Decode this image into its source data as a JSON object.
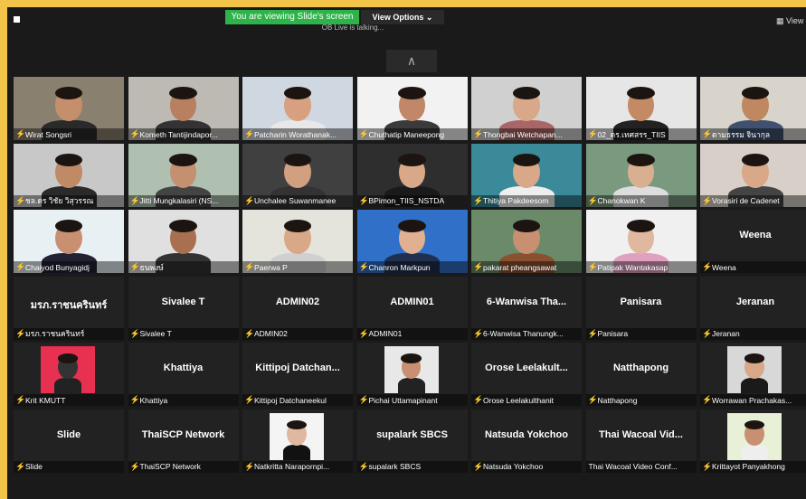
{
  "banner": "You are viewing Slide's screen",
  "view_options": "View Options ⌄",
  "talking": "OB Live is talking...",
  "view_label": "▦ View",
  "collapse_icon": "∧",
  "participants": [
    {
      "name": "Wirat Songsri",
      "video": true,
      "bg": "#8a8070",
      "skin": "#c48f6a",
      "shirt": "#2a2a2a"
    },
    {
      "name": "Kometh Tantijindapor...",
      "video": true,
      "bg": "#bdbab4",
      "skin": "#b88060",
      "shirt": "#333"
    },
    {
      "name": "Patcharin Worathanak...",
      "video": true,
      "bg": "#cfd8e0",
      "skin": "#d8a080",
      "shirt": "#e8e8e8"
    },
    {
      "name": "Chuthatip Maneepong",
      "video": true,
      "bg": "#f2f2f2",
      "skin": "#c08868",
      "shirt": "#3a3a3a"
    },
    {
      "name": "Thongbai Wetchapan...",
      "video": true,
      "bg": "#d0d0d0",
      "skin": "#d8a888",
      "shirt": "#aa6666"
    },
    {
      "name": "02_ดร.เทศสรร_TIIS",
      "video": true,
      "bg": "#e6e6e6",
      "skin": "#c48a64",
      "shirt": "#222"
    },
    {
      "name": "ดามธรรม จินากุล",
      "video": true,
      "bg": "#d8d4cc",
      "skin": "#c08860",
      "shirt": "#405070"
    },
    {
      "name": "ชล.ดร วิชัย  วิสุวรรณ",
      "video": true,
      "bg": "#c8c8c8",
      "skin": "#c08a66",
      "shirt": "#2a2a2a"
    },
    {
      "name": "Jitti Mungkalasiri (NS...",
      "video": true,
      "bg": "#b0c0b0",
      "skin": "#c49070",
      "shirt": "#444"
    },
    {
      "name": "Unchalee Suwanmanee",
      "video": true,
      "bg": "#404040",
      "skin": "#d0a080",
      "shirt": "#333"
    },
    {
      "name": "BPimon_TIIS_NSTDA",
      "video": true,
      "bg": "#2e2e2e",
      "skin": "#d8a888",
      "shirt": "#1a1a1a"
    },
    {
      "name": "Thitiya Pakdeesom",
      "video": true,
      "bg": "#3a8a9a",
      "skin": "#d8a888",
      "shirt": "#eeeeee"
    },
    {
      "name": "Chanokwan K",
      "video": true,
      "bg": "#7a9a80",
      "skin": "#d8b090",
      "shirt": "#ddd"
    },
    {
      "name": "Vorasiri de Cadenet",
      "video": true,
      "bg": "#d8d0c8",
      "skin": "#d8a888",
      "shirt": "#444"
    },
    {
      "name": "Chaiyod Bunyagidj",
      "video": true,
      "bg": "#e8f0f4",
      "skin": "#c89070",
      "shirt": "#223"
    },
    {
      "name": "ธนพงษ์",
      "video": true,
      "bg": "#e0e0e0",
      "skin": "#a87050",
      "shirt": "#333"
    },
    {
      "name": "Paerwa P",
      "video": true,
      "bg": "#e4e4dc",
      "skin": "#d8a888",
      "shirt": "#d0d0d0"
    },
    {
      "name": "Chanron  Markpun",
      "video": true,
      "bg": "#3070c8",
      "skin": "#e0b090",
      "shirt": "#203050"
    },
    {
      "name": "pakarat pheangsawat",
      "video": true,
      "bg": "#6a8a6a",
      "skin": "#c89070",
      "shirt": "#8a5030"
    },
    {
      "name": "Patipak Wantakasap",
      "video": true,
      "bg": "#f0f0f0",
      "skin": "#e0b8a0",
      "shirt": "#e0a0c0"
    },
    {
      "name": "Weena",
      "video": false,
      "big": "Weena"
    },
    {
      "name": "มรภ.ราชนครินทร์",
      "video": false,
      "big": "มรภ.ราชนครินทร์"
    },
    {
      "name": "Sivalee T",
      "video": false,
      "big": "Sivalee T"
    },
    {
      "name": "ADMIN02",
      "video": false,
      "big": "ADMIN02"
    },
    {
      "name": "ADMIN01",
      "video": false,
      "big": "ADMIN01"
    },
    {
      "name": "6-Wanwisa Thanungk...",
      "video": false,
      "big": "6-Wanwisa  Tha..."
    },
    {
      "name": "Panisara",
      "video": false,
      "big": "Panisara"
    },
    {
      "name": "Jeranan",
      "video": false,
      "big": "Jeranan"
    },
    {
      "name": "Krit KMUTT",
      "video": true,
      "bg": "#e83050",
      "skin": "#333",
      "shirt": "#222",
      "small": true
    },
    {
      "name": "Khattiya",
      "video": false,
      "big": "Khattiya"
    },
    {
      "name": "Kittipoj Datchaneekul",
      "video": false,
      "big": "Kittipoj  Datchan..."
    },
    {
      "name": "Pichai Uttamapinant",
      "video": true,
      "bg": "#e8e8e8",
      "skin": "#c89070",
      "shirt": "#222",
      "small": true
    },
    {
      "name": "Orose Leelakulthanit",
      "video": false,
      "big": "Orose  Leelakult..."
    },
    {
      "name": "Natthapong",
      "video": false,
      "big": "Natthapong"
    },
    {
      "name": "Worrawan Prachakas...",
      "video": true,
      "bg": "#d8d8d8",
      "skin": "#d8a888",
      "shirt": "#1a1a1a",
      "small": true
    },
    {
      "name": "Slide",
      "video": false,
      "big": "Slide"
    },
    {
      "name": "ThaiSCP Network",
      "video": false,
      "big": "ThaiSCP Network"
    },
    {
      "name": "Natkritta Narapornpi...",
      "video": true,
      "bg": "#f4f4f4",
      "skin": "#e0b8a0",
      "shirt": "#111",
      "small": true
    },
    {
      "name": "supalark SBCS",
      "video": false,
      "big": "supalark SBCS"
    },
    {
      "name": "Natsuda Yokchoo",
      "video": false,
      "big": "Natsuda Yokchoo"
    },
    {
      "name": "Thai Wacoal Video Conf...",
      "video": false,
      "big": "Thai  Wacoal  Vid...",
      "nomic": true
    },
    {
      "name": "Krittayot Panyakhong",
      "video": true,
      "bg": "#e8f0d8",
      "skin": "#c89070",
      "shirt": "#eee",
      "small": true
    }
  ]
}
